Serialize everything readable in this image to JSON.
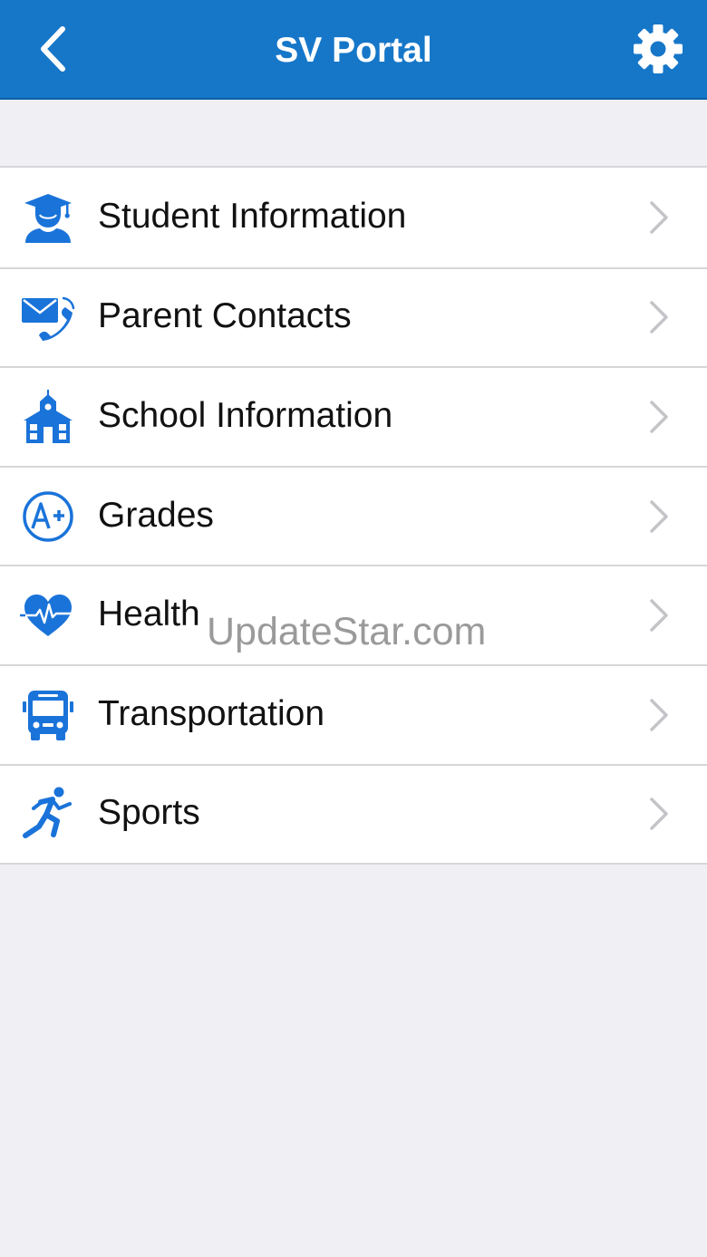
{
  "header": {
    "title": "SV Portal",
    "back_icon": "chevron-left-icon",
    "settings_icon": "gear-icon"
  },
  "colors": {
    "accent": "#1677c9",
    "icon_blue": "#1a73d9",
    "background": "#efeff4",
    "separator": "#d6d6da",
    "chevron": "#c4c4c8"
  },
  "menu": {
    "items": [
      {
        "label": "Student Information",
        "icon": "graduate-icon"
      },
      {
        "label": "Parent Contacts",
        "icon": "envelope-phone-icon"
      },
      {
        "label": "School Information",
        "icon": "schoolhouse-icon"
      },
      {
        "label": "Grades",
        "icon": "a-plus-icon"
      },
      {
        "label": "Health",
        "icon": "heart-pulse-icon"
      },
      {
        "label": "Transportation",
        "icon": "bus-icon"
      },
      {
        "label": "Sports",
        "icon": "runner-icon"
      }
    ]
  },
  "watermark": {
    "text": "UpdateStar.com"
  }
}
